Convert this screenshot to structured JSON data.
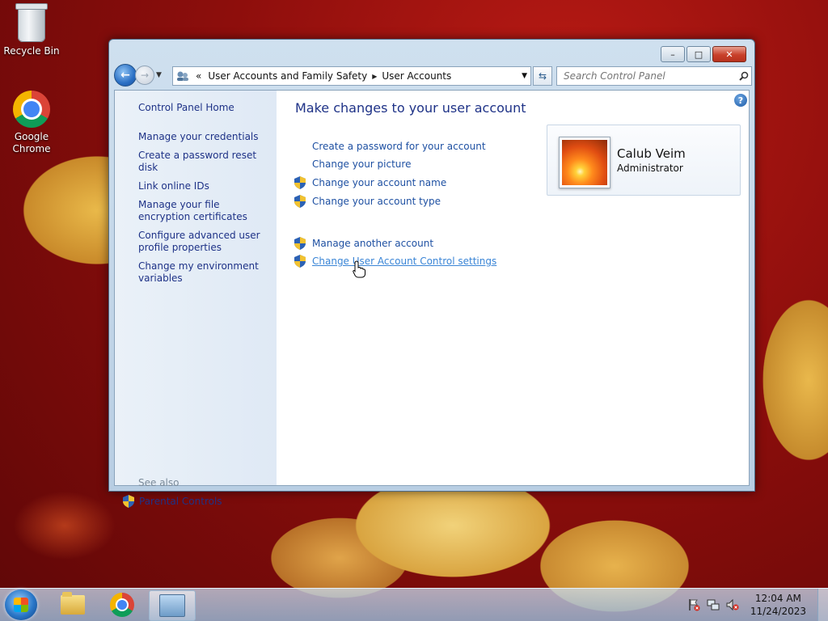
{
  "desktop": {
    "icons": [
      {
        "label": "Recycle Bin",
        "icon": "recycle-bin-icon"
      },
      {
        "label": "Google\nChrome",
        "icon": "chrome-icon"
      }
    ]
  },
  "window": {
    "buttons": {
      "minimize": "–",
      "maximize": "□",
      "close": "✕"
    },
    "nav": {
      "back": "←",
      "forward": "→"
    },
    "address": {
      "overflow": "«",
      "breadcrumb": [
        "User Accounts and Family Safety",
        "User Accounts"
      ]
    },
    "search": {
      "placeholder": "Search Control Panel"
    },
    "left_pane": {
      "home": "Control Panel Home",
      "links": [
        "Manage your credentials",
        "Create a password reset disk",
        "Link online IDs",
        "Manage your file encryption certificates",
        "Configure advanced user profile properties",
        "Change my environment variables"
      ],
      "see_also": "See also",
      "parental_controls": "Parental Controls"
    },
    "main": {
      "heading": "Make changes to your user account",
      "help": "?",
      "tasks": [
        {
          "label": "Create a password for your account",
          "shield": false
        },
        {
          "label": "Change your picture",
          "shield": false
        },
        {
          "label": "Change your account name",
          "shield": true
        },
        {
          "label": "Change your account type",
          "shield": true
        },
        {
          "label": "Manage another account",
          "shield": true
        },
        {
          "label": "Change User Account Control settings",
          "shield": true,
          "hover": true
        }
      ],
      "user": {
        "name": "Calub Veim",
        "role": "Administrator"
      }
    }
  },
  "taskbar": {
    "items": [
      "windows-explorer",
      "google-chrome",
      "control-panel"
    ],
    "clock": {
      "time": "12:04 AM",
      "date": "11/24/2023"
    }
  },
  "colors": {
    "link": "#1e50a2",
    "heading": "#1e3287",
    "hover_link": "#3a85d6"
  }
}
